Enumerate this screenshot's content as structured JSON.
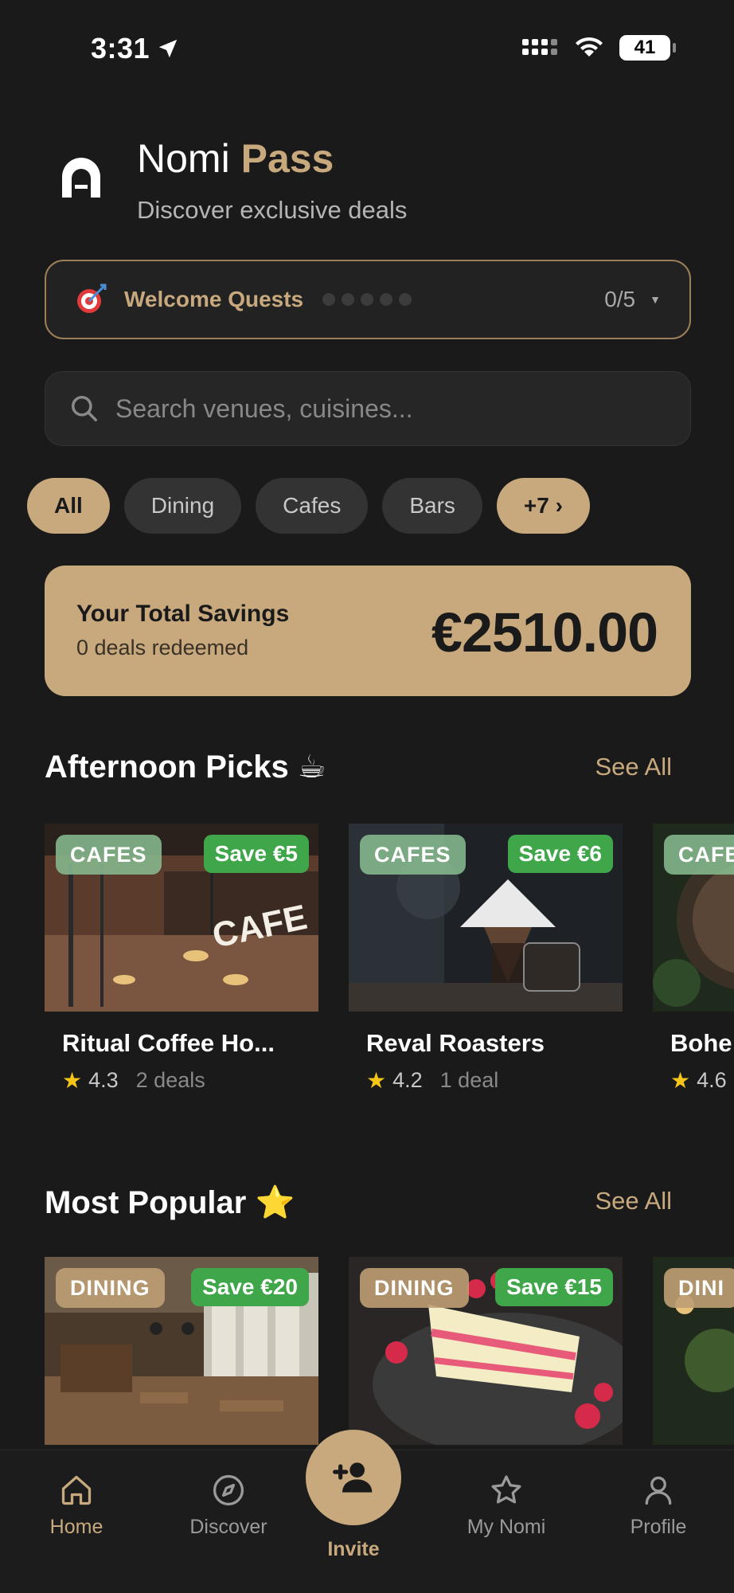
{
  "status": {
    "time": "3:31",
    "battery": "41"
  },
  "header": {
    "title_prefix": "Nomi",
    "title_accent": "Pass",
    "subtitle": "Discover exclusive deals"
  },
  "quests": {
    "label": "Welcome Quests",
    "progress_text": "0/5",
    "completed": 0,
    "total": 5
  },
  "search": {
    "placeholder": "Search venues, cuisines..."
  },
  "chips": [
    {
      "label": "All",
      "active": true
    },
    {
      "label": "Dining",
      "active": false
    },
    {
      "label": "Cafes",
      "active": false
    },
    {
      "label": "Bars",
      "active": false
    },
    {
      "label": "+7 ›",
      "active": false
    }
  ],
  "savings": {
    "label": "Your Total Savings",
    "sub": "0 deals redeemed",
    "amount": "€2510.00"
  },
  "afternoon": {
    "title": "Afternoon Picks ☕",
    "see_all": "See All",
    "cards": [
      {
        "category": "CAFES",
        "save": "Save €5",
        "name": "Ritual Coffee Ho...",
        "rating": "4.3",
        "deals": "2 deals"
      },
      {
        "category": "CAFES",
        "save": "Save €6",
        "name": "Reval Roasters",
        "rating": "4.2",
        "deals": "1 deal"
      },
      {
        "category": "CAFE",
        "save": "",
        "name": "Bohe",
        "rating": "4.6",
        "deals": ""
      }
    ]
  },
  "popular": {
    "title": "Most Popular ⭐",
    "see_all": "See All",
    "cards": [
      {
        "category": "DINING",
        "save": "Save €20"
      },
      {
        "category": "DINING",
        "save": "Save €15"
      },
      {
        "category": "DINI",
        "save": ""
      }
    ]
  },
  "nav": {
    "home": "Home",
    "discover": "Discover",
    "invite": "Invite",
    "my_nomi": "My Nomi",
    "profile": "Profile"
  },
  "colors": {
    "accent": "#c8a97e",
    "background": "#1a1a1a",
    "save_green": "#3fa74a"
  }
}
